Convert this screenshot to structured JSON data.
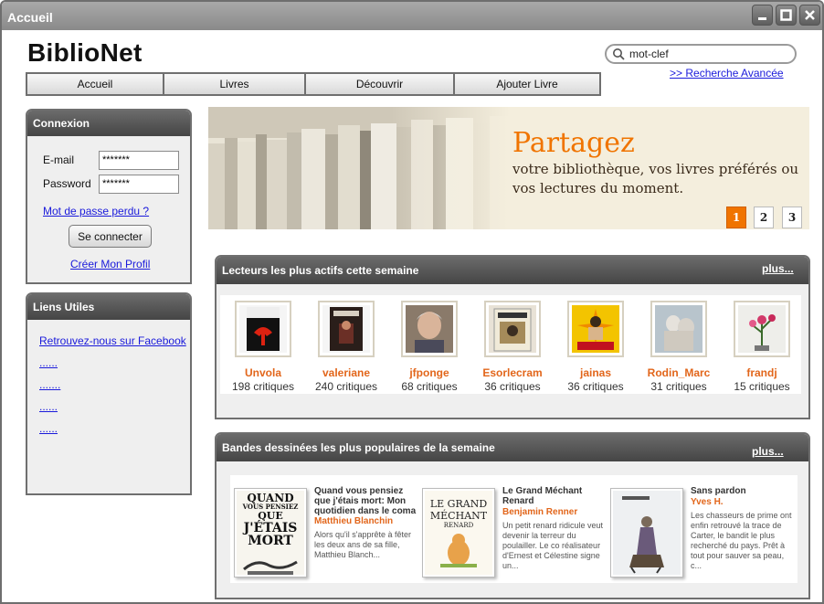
{
  "window": {
    "title": "Accueil"
  },
  "brand": {
    "logo": "BiblioNet"
  },
  "search": {
    "value": "mot-clef",
    "advanced_link": ">> Recherche Avancée"
  },
  "nav": [
    "Accueil",
    "Livres",
    "Découvrir",
    "Ajouter Livre"
  ],
  "login": {
    "title": "Connexion",
    "email_label": "E-mail",
    "email_value": "*******",
    "password_label": "Password",
    "password_value": "*******",
    "forgot_link": "Mot de passe perdu ?",
    "submit_label": "Se connecter",
    "create_profile_link": "Créer Mon Profil"
  },
  "useful_links": {
    "title": "Liens Utiles",
    "items": [
      "Retrouvez-nous sur Facebook",
      "......",
      ".......",
      "......",
      "......"
    ]
  },
  "banner": {
    "title": "Partagez",
    "text": "votre bibliothèque, vos livres préférés ou vos lectures du moment.",
    "pages": [
      "1",
      "2",
      "3"
    ],
    "active_page": "1",
    "accent_color": "#f07400"
  },
  "readers_section": {
    "title": "Lecteurs les plus actifs cette semaine",
    "more_link": "plus...",
    "readers": [
      {
        "name": "Unvola",
        "count": "198 critiques",
        "avatar": "book-cover-red-icon"
      },
      {
        "name": "valeriane",
        "count": "240 critiques",
        "avatar": "book-cover-dark-icon"
      },
      {
        "name": "jfponge",
        "count": "68 critiques",
        "avatar": "portrait-photo-icon"
      },
      {
        "name": "Esorlecram",
        "count": "36 critiques",
        "avatar": "book-cover-icon"
      },
      {
        "name": "jainas",
        "count": "36 critiques",
        "avatar": "bruce-lee-poster-icon"
      },
      {
        "name": "Rodin_Marc",
        "count": "31 critiques",
        "avatar": "sculpture-icon"
      },
      {
        "name": "frandj",
        "count": "15 critiques",
        "avatar": "flower-icon"
      }
    ]
  },
  "comics_section": {
    "title": "Bandes dessinées les plus populaires de la semaine",
    "more_link": "plus...",
    "items": [
      {
        "title": "Quand vous pensiez que j'étais mort: Mon quotidien dans le coma",
        "author": "Matthieu Blanchin",
        "desc": "Alors qu'il s'apprête à fêter les deux ans de sa fille, Matthieu Blanch...",
        "cover_text": [
          "QUAND",
          "VOUS PENSIEZ",
          "QUE",
          "J'ÉTAIS",
          "MORT"
        ]
      },
      {
        "title": "Le Grand Méchant Renard",
        "author": "Benjamin Renner",
        "desc": "Un petit renard ridicule veut devenir la terreur du poulailler. Le co réalisateur d'Ernest et Célestine signe un...",
        "cover_text": [
          "LE GRAND",
          "MÉCHANT",
          "RENARD"
        ]
      },
      {
        "title": "Sans pardon",
        "author": "Yves H.",
        "desc": "Les chasseurs de prime ont enfin retrouvé la trace de Carter, le bandit le plus recherché du pays. Prêt à tout pour sauver sa peau, c...",
        "cover_text": []
      }
    ]
  }
}
